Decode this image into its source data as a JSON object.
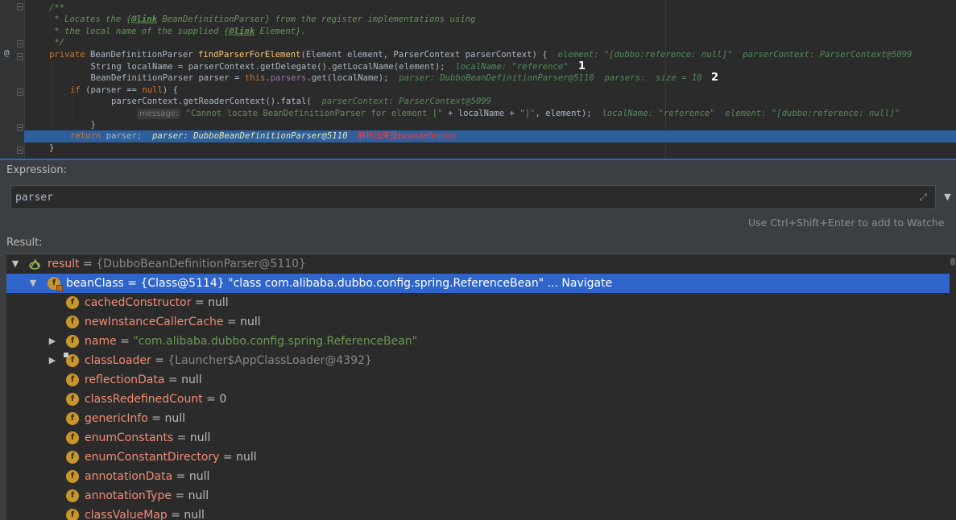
{
  "editor": {
    "lines": {
      "l1": "/**",
      "l2a": " * Locates the {",
      "l2b": "@link",
      "l2c": " BeanDefinitionParser} from the register implementations using",
      "l3a": " * the local name of the supplied {",
      "l3b": "@link",
      "l3c": " Element}.",
      "l4": " */",
      "l5kw": "private",
      "l5a": " BeanDefinitionParser ",
      "l5fn": "findParserForElement",
      "l5b": "(Element element, ParserContext parserContext) {",
      "l5h": "element: \"[dubbo:reference: null]\"  parserContext: ParserContext@5099",
      "l6": "    String localName = parserContext.getDelegate().getLocalName(element);",
      "l6h": "localName: \"reference\"",
      "l7a": "    BeanDefinitionParser parser = ",
      "l7kw": "this",
      "l7b": ".",
      "l7fld": "parsers",
      "l7c": ".get(localName);",
      "l7h": "parser: DubboBeanDefinitionParser@5110  parsers:  size = 10",
      "l8kw": "if",
      "l8a": " (parser == ",
      "l8kw2": "null",
      "l8b": ") {",
      "l9": "        parserContext.getReaderContext().fatal(",
      "l9h": "parserContext: ParserContext@5099",
      "l10p": "message:",
      "l10s": "\"Cannot locate BeanDefinitionParser for element [\"",
      "l10a": " + localName + ",
      "l10s2": "\"]\"",
      "l10b": ", element);",
      "l10h": "localName: \"reference\"  element: \"[dubbo:reference: null]\"",
      "l11": "    }",
      "l12kw": "return",
      "l12a": " parser;",
      "l12h": "parser: DubboBeanDefinitionParser@5110",
      "l12cn": "解析出来是beandefinition",
      "l13": "}"
    },
    "annotation_1": "1",
    "annotation_2": "2",
    "gutter_mark": "@"
  },
  "panel": {
    "expression_label": "Expression:",
    "expression_value": "parser",
    "hint": "Use Ctrl+Shift+Enter to add to Watche",
    "result_label": "Result:",
    "history_button": "▼",
    "expand_icon": "⤢"
  },
  "tree": [
    {
      "name": "result",
      "eq": " = ",
      "value": "{DubboBeanDefinitionParser@5110}",
      "style": "gray"
    },
    {
      "name": "beanClass",
      "eq": " = ",
      "value": "{Class@5114} \"class com.alibaba.dubbo.config.spring.ReferenceBean\" ... Navigate",
      "style": "plain"
    },
    {
      "name": "cachedConstructor",
      "eq": " = ",
      "value": "null",
      "style": "plain"
    },
    {
      "name": "newInstanceCallerCache",
      "eq": " = ",
      "value": "null",
      "style": "plain"
    },
    {
      "name": "name",
      "eq": " = ",
      "value": "\"com.alibaba.dubbo.config.spring.ReferenceBean\"",
      "style": "str"
    },
    {
      "name": "classLoader",
      "eq": " = ",
      "value": "{Launcher$AppClassLoader@4392}",
      "style": "gray"
    },
    {
      "name": "reflectionData",
      "eq": " = ",
      "value": "null",
      "style": "plain"
    },
    {
      "name": "classRedefinedCount",
      "eq": " = ",
      "value": "0",
      "style": "plain"
    },
    {
      "name": "genericInfo",
      "eq": " = ",
      "value": "null",
      "style": "plain"
    },
    {
      "name": "enumConstants",
      "eq": " = ",
      "value": "null",
      "style": "plain"
    },
    {
      "name": "enumConstantDirectory",
      "eq": " = ",
      "value": "null",
      "style": "plain"
    },
    {
      "name": "annotationData",
      "eq": " = ",
      "value": "null",
      "style": "plain"
    },
    {
      "name": "annotationType",
      "eq": " = ",
      "value": "null",
      "style": "plain"
    },
    {
      "name": "classValueMap",
      "eq": " = ",
      "value": "null",
      "style": "plain"
    }
  ],
  "icons": {
    "field": "f",
    "expand_open": "▼",
    "expand_closed": "▶"
  },
  "colors": {
    "selection": "#2f65ca",
    "field_name": "#f08c74",
    "field_icon": "#c8962a",
    "comment": "#629755",
    "keyword": "#cc7832"
  }
}
